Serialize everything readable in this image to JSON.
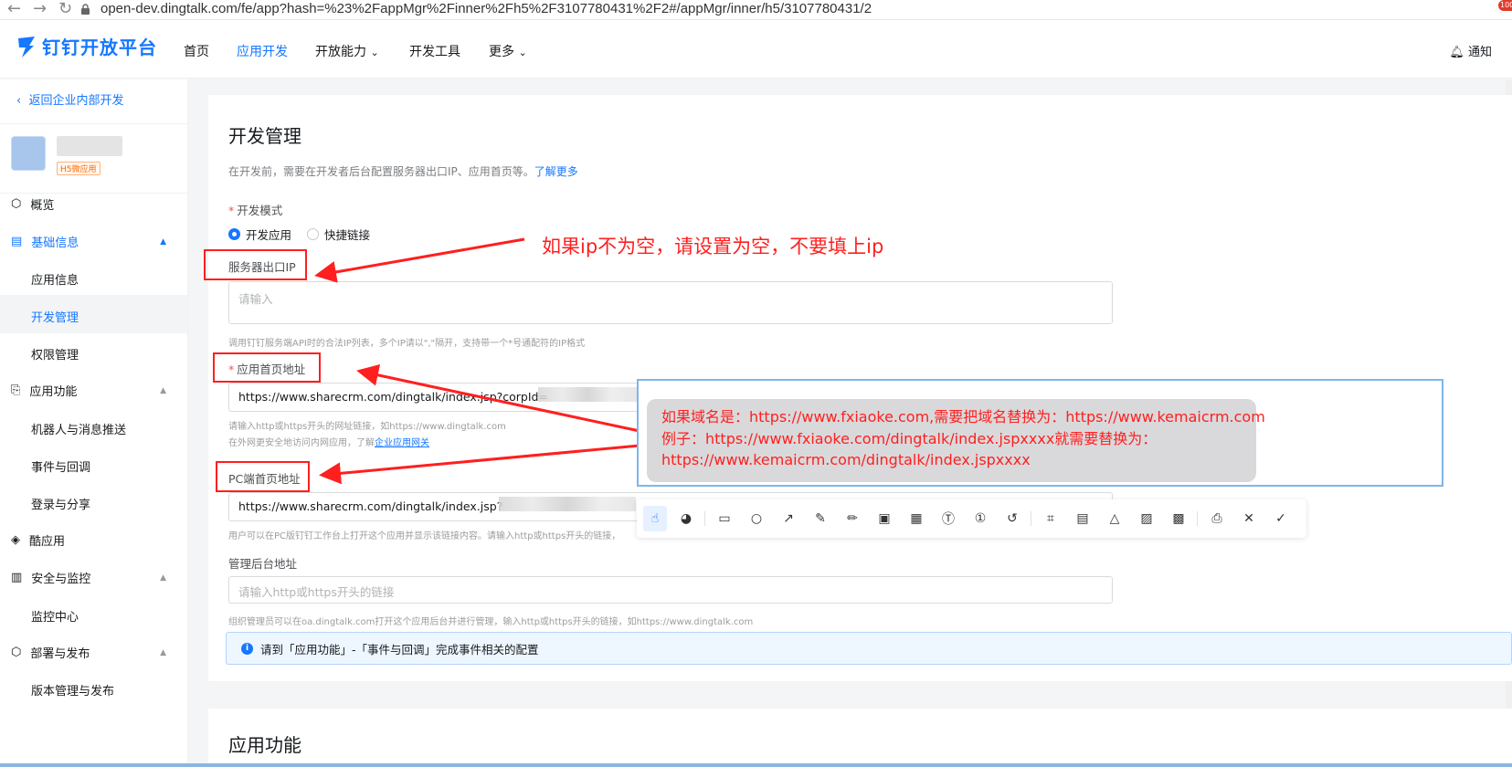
{
  "browser": {
    "url": "open-dev.dingtalk.com/fe/app?hash=%23%2FappMgr%2Finner%2Fh5%2F3107780431%2F2#/appMgr/inner/h5/3107780431/2",
    "badge": "100"
  },
  "header": {
    "logo": "钉钉开放平台",
    "nav": [
      "首页",
      "应用开发",
      "开放能力",
      "开发工具",
      "更多"
    ],
    "notify": "通知"
  },
  "sidebar": {
    "back": "返回企业内部开发",
    "app_tag": "H5微应用",
    "groups": [
      {
        "label": "概览"
      },
      {
        "label": "基础信息",
        "items": [
          "应用信息",
          "开发管理",
          "权限管理"
        ]
      },
      {
        "label": "应用功能",
        "items": [
          "机器人与消息推送",
          "事件与回调",
          "登录与分享"
        ]
      },
      {
        "label": "酷应用"
      },
      {
        "label": "安全与监控",
        "items": [
          "监控中心"
        ]
      },
      {
        "label": "部署与发布",
        "items": [
          "版本管理与发布"
        ]
      }
    ]
  },
  "main": {
    "title": "开发管理",
    "desc": "在开发前，需要在开发者后台配置服务器出口IP、应用首页等。",
    "desc_link": "了解更多",
    "dev_mode_label": "开发模式",
    "radio_options": [
      "开发应用",
      "快捷链接"
    ],
    "ip_label": "服务器出口IP",
    "ip_placeholder": "请输入",
    "ip_hint": "调用钉钉服务端API时的合法IP列表，多个IP请以\",\"隔开，支持带一个*号通配符的IP格式",
    "home_label": "应用首页地址",
    "home_value": "https://www.sharecrm.com/dingtalk/index.jsp?corpId=",
    "home_hint1": "请输入http或https开头的网址链接，如https://www.dingtalk.com",
    "home_hint2": "在外网更安全地访问内网应用，了解",
    "home_hint2_link": "企业应用网关",
    "pc_label": "PC端首页地址",
    "pc_value": "https://www.sharecrm.com/dingtalk/index.jsp?",
    "pc_hint": "用户可以在PC版钉钉工作台上打开这个应用并显示该链接内容。请输入http或https开头的链接，",
    "admin_label": "管理后台地址",
    "admin_placeholder": "请输入http或https开头的链接",
    "admin_hint": "组织管理员可以在oa.dingtalk.com打开这个应用后台并进行管理，输入http或https开头的链接，如https://www.dingtalk.com",
    "info_text": "请到「应用功能」-「事件与回调」完成事件相关的配置",
    "section2_title": "应用功能"
  },
  "annotations": {
    "ip_note": "如果ip不为空，请设置为空，不要填上ip",
    "bubble_lines": [
      "如果域名是：https://www.fxiaoke.com,需要把域名替换为：https://www.kemaicrm.com",
      "例子：https://www.fxiaoke.com/dingtalk/index.jspxxxx就需要替换为：",
      "https://www.kemaicrm.com/dingtalk/index.jspxxxx"
    ],
    "color": "#ff1f1f"
  },
  "toolbar_icons": [
    "pointer-icon",
    "palette-icon",
    "rectangle-icon",
    "circle-icon",
    "arrow-icon",
    "marker-icon",
    "pencil-icon",
    "mosaic-icon",
    "blur-icon",
    "text-icon",
    "number-icon",
    "undo-icon",
    "scan-icon",
    "ocr-icon",
    "shapes-icon",
    "pin-image-icon",
    "qrcode-icon",
    "save-icon",
    "close-icon",
    "confirm-icon"
  ],
  "accent": "#1677ff"
}
